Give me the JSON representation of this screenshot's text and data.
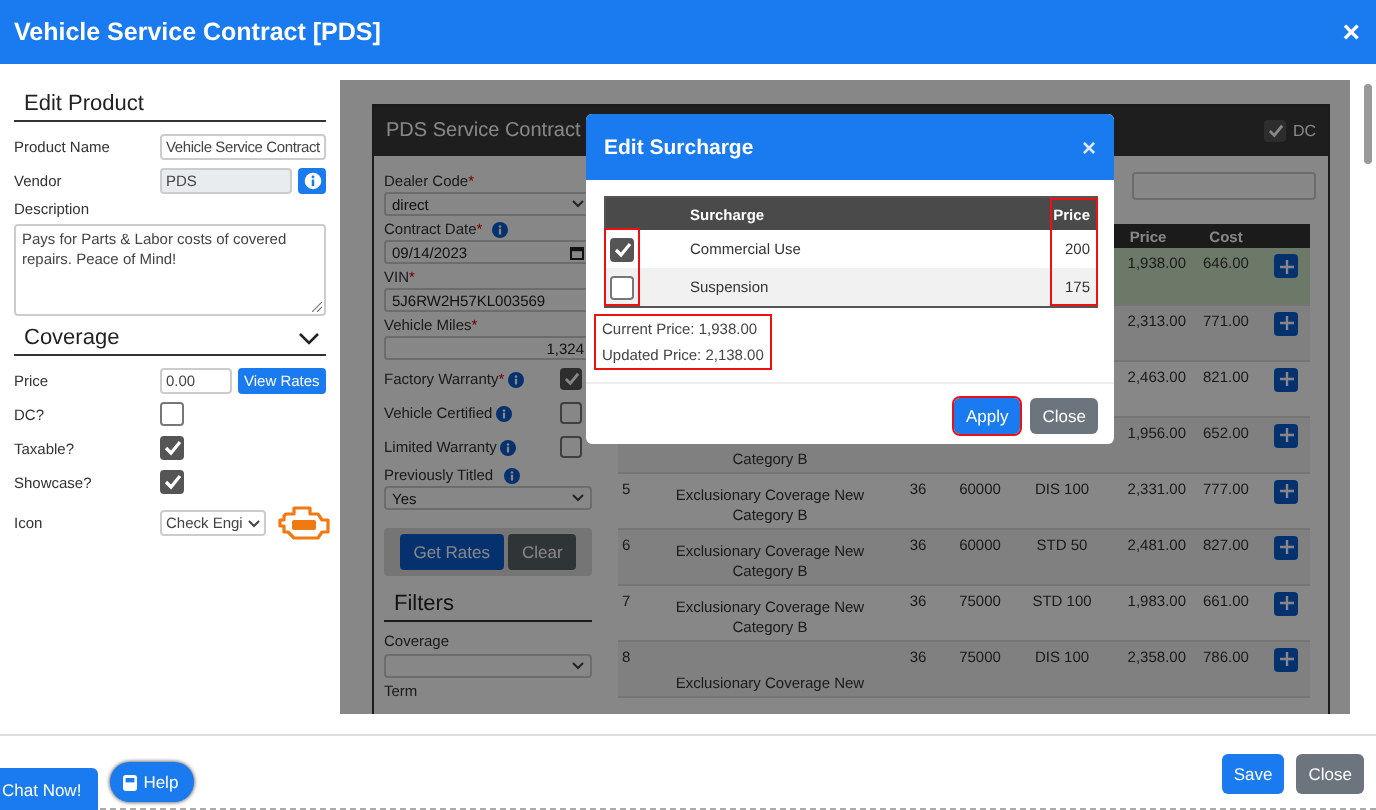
{
  "window": {
    "title": "Vehicle Service Contract [PDS]",
    "close": "×"
  },
  "edit_product": {
    "heading": "Edit Product",
    "fields": [
      {
        "label": "Product Name",
        "kind": "text",
        "value": "Vehicle Service Contract"
      },
      {
        "label": "Vendor",
        "kind": "readonly-info",
        "value": "PDS"
      },
      {
        "label": "Description",
        "kind": "textarea",
        "value": "Pays for Parts & Labor costs of covered repairs. Peace of Mind!"
      }
    ]
  },
  "coverage": {
    "heading": "Coverage",
    "expanded": true,
    "fields": [
      {
        "label": "Price",
        "kind": "price",
        "value": "0.00",
        "button": "View Rates"
      },
      {
        "label": "DC?",
        "kind": "checkbox",
        "checked": false
      },
      {
        "label": "Taxable?",
        "kind": "checkbox",
        "checked": true
      },
      {
        "label": "Showcase?",
        "kind": "checkbox",
        "checked": true
      },
      {
        "label": "Icon",
        "kind": "select",
        "value": "Check Engi"
      }
    ]
  },
  "embedded_page": {
    "panel_title": "PDS Service Contract",
    "dc": {
      "label": "DC",
      "checked": true
    },
    "form": [
      {
        "label": "Dealer Code",
        "required_mark": "*",
        "info": false,
        "kind": "select",
        "value": "direct"
      },
      {
        "label": "Contract Date",
        "required_mark": "*",
        "info": true,
        "kind": "date",
        "value": "09/14/2023"
      },
      {
        "label": "VIN",
        "required_mark": "*",
        "info": false,
        "kind": "text",
        "value": "5J6RW2H57KL003569"
      },
      {
        "label": "Vehicle Miles",
        "required_mark": "*",
        "info": false,
        "kind": "number",
        "value": "1,324"
      },
      {
        "label": "Factory Warranty",
        "required_mark": "*",
        "info": true,
        "kind": "checkbox",
        "checked": true
      },
      {
        "label": "Vehicle Certified",
        "info": true,
        "kind": "checkbox",
        "checked": false
      },
      {
        "label": "Limited Warranty",
        "info": true,
        "kind": "checkbox",
        "checked": false
      },
      {
        "label": "Previously Titled",
        "info": true,
        "kind": "select",
        "value": "Yes"
      }
    ],
    "buttons": [
      {
        "label": "Get Rates",
        "kind": "primary"
      },
      {
        "label": "Clear",
        "kind": "secondary"
      }
    ],
    "filters": {
      "heading": "Filters",
      "fields": [
        {
          "label": "Coverage",
          "kind": "select"
        },
        {
          "label": "Term",
          "kind": "label"
        }
      ]
    },
    "rates_table": {
      "columns": [
        "Price",
        "Cost"
      ],
      "rows": [
        {
          "number": "",
          "coverage": "",
          "term": "",
          "miles": "",
          "deductible": "",
          "price": "1,938.00",
          "cost": "646.00",
          "selected": true
        },
        {
          "number": "",
          "coverage": "",
          "term": "",
          "miles": "",
          "deductible": "",
          "price": "2,313.00",
          "cost": "771.00",
          "selected": false
        },
        {
          "number": "",
          "coverage": "",
          "term": "",
          "miles": "",
          "deductible": "",
          "price": "2,463.00",
          "cost": "821.00",
          "selected": false
        },
        {
          "number": "",
          "coverage": "Category B",
          "term": "",
          "miles": "",
          "deductible": "",
          "price": "1,956.00",
          "cost": "652.00",
          "selected": false
        },
        {
          "number": "5",
          "coverage": "Exclusionary Coverage New Category B",
          "term": "36",
          "miles": "60000",
          "deductible": "DIS 100",
          "price": "2,331.00",
          "cost": "777.00",
          "selected": false
        },
        {
          "number": "6",
          "coverage": "Exclusionary Coverage New Category B",
          "term": "36",
          "miles": "60000",
          "deductible": "STD 50",
          "price": "2,481.00",
          "cost": "827.00",
          "selected": false
        },
        {
          "number": "7",
          "coverage": "Exclusionary Coverage New Category B",
          "term": "36",
          "miles": "75000",
          "deductible": "STD 100",
          "price": "1,983.00",
          "cost": "661.00",
          "selected": false
        },
        {
          "number": "8",
          "coverage": "Exclusionary Coverage New",
          "term": "36",
          "miles": "75000",
          "deductible": "DIS 100",
          "price": "2,358.00",
          "cost": "786.00",
          "selected": false
        }
      ]
    }
  },
  "modal": {
    "title": "Edit Surcharge",
    "close": "×",
    "columns": [
      "Surcharge",
      "Price"
    ],
    "rows": [
      {
        "name": "Commercial Use",
        "price": "200",
        "checked": true
      },
      {
        "name": "Suspension",
        "price": "175",
        "checked": false
      }
    ],
    "current_price": "Current Price: 1,938.00",
    "updated_price": "Updated Price: 2,138.00",
    "buttons": [
      {
        "label": "Apply",
        "kind": "primary",
        "highlighted": true
      },
      {
        "label": "Close",
        "kind": "secondary",
        "highlighted": false
      }
    ],
    "highlights": {
      "checkbox_column": true,
      "price_column": true,
      "price_summary": true
    }
  },
  "footer": {
    "chat": "Chat Now!",
    "help": "Help",
    "buttons": [
      {
        "label": "Save",
        "kind": "primary"
      },
      {
        "label": "Close",
        "kind": "secondary"
      }
    ]
  }
}
